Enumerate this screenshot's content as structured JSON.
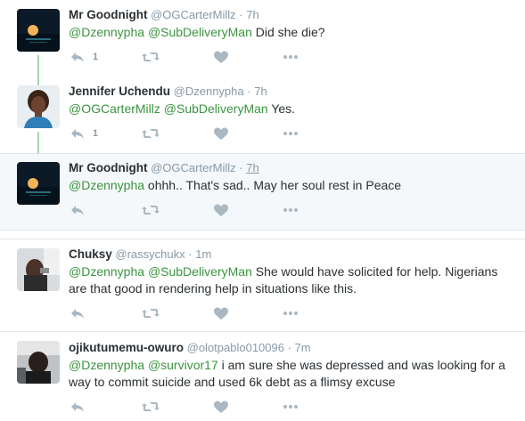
{
  "colors": {
    "mention": "#3b9440",
    "icon": "#aab8c2",
    "thread_line": "#a5d6a7",
    "highlight_bg": "#f5f8fa"
  },
  "tweets": [
    {
      "name": "Mr Goodnight",
      "handle": "@OGCarterMillz",
      "dot": "·",
      "time": "7h",
      "mentions": [
        "@Dzennypha",
        "@SubDeliveryMan"
      ],
      "text": " Did she die?",
      "reply_count": "1",
      "avatar": "moon-night-avatar"
    },
    {
      "name": "Jennifer Uchendu",
      "handle": "@Dzennypha",
      "dot": "·",
      "time": "7h",
      "mentions": [
        "@OGCarterMillz",
        "@SubDeliveryMan"
      ],
      "text": " Yes.",
      "reply_count": "1",
      "avatar": "woman-portrait-avatar"
    },
    {
      "name": "Mr Goodnight",
      "handle": "@OGCarterMillz",
      "dot": "·",
      "time": "7h",
      "mentions": [
        "@Dzennypha"
      ],
      "text": " ohhh.. That's sad.. May her soul rest in Peace",
      "reply_count": "",
      "avatar": "moon-night-avatar"
    },
    {
      "name": "Chuksy",
      "handle": "@rassychukx",
      "dot": "·",
      "time": "1m",
      "mentions": [
        "@Dzennypha",
        "@SubDeliveryMan"
      ],
      "text_line1": " She would have solicited for help. Nigerians",
      "text_line2": "are that good in rendering help in situations like this.",
      "reply_count": "",
      "avatar": "man-phone-avatar"
    },
    {
      "name": "ojikutumemu-owuro",
      "handle": "@olotpablo010096",
      "dot": "·",
      "time": "7m",
      "mentions": [
        "@Dzennypha",
        "@survivor17"
      ],
      "text_line1": " i am sure she was  depressed and was looking for a",
      "text_line2": "way to commit suicide  and used 6k debt as a flimsy excuse",
      "reply_count": "",
      "avatar": "car-selfie-avatar"
    }
  ]
}
